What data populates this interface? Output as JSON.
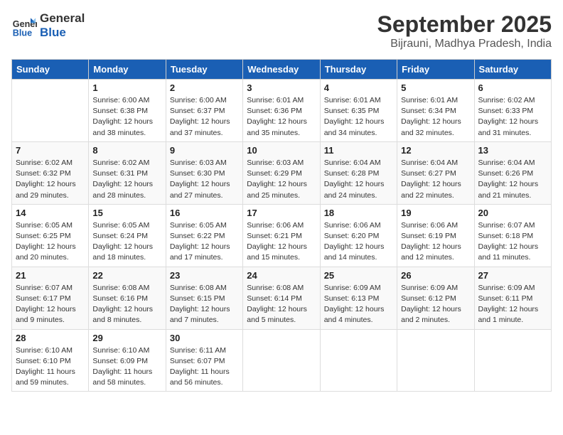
{
  "header": {
    "logo_line1": "General",
    "logo_line2": "Blue",
    "month": "September 2025",
    "location": "Bijrauni, Madhya Pradesh, India"
  },
  "days_of_week": [
    "Sunday",
    "Monday",
    "Tuesday",
    "Wednesday",
    "Thursday",
    "Friday",
    "Saturday"
  ],
  "weeks": [
    [
      {
        "day": "",
        "detail": ""
      },
      {
        "day": "1",
        "detail": "Sunrise: 6:00 AM\nSunset: 6:38 PM\nDaylight: 12 hours\nand 38 minutes."
      },
      {
        "day": "2",
        "detail": "Sunrise: 6:00 AM\nSunset: 6:37 PM\nDaylight: 12 hours\nand 37 minutes."
      },
      {
        "day": "3",
        "detail": "Sunrise: 6:01 AM\nSunset: 6:36 PM\nDaylight: 12 hours\nand 35 minutes."
      },
      {
        "day": "4",
        "detail": "Sunrise: 6:01 AM\nSunset: 6:35 PM\nDaylight: 12 hours\nand 34 minutes."
      },
      {
        "day": "5",
        "detail": "Sunrise: 6:01 AM\nSunset: 6:34 PM\nDaylight: 12 hours\nand 32 minutes."
      },
      {
        "day": "6",
        "detail": "Sunrise: 6:02 AM\nSunset: 6:33 PM\nDaylight: 12 hours\nand 31 minutes."
      }
    ],
    [
      {
        "day": "7",
        "detail": "Sunrise: 6:02 AM\nSunset: 6:32 PM\nDaylight: 12 hours\nand 29 minutes."
      },
      {
        "day": "8",
        "detail": "Sunrise: 6:02 AM\nSunset: 6:31 PM\nDaylight: 12 hours\nand 28 minutes."
      },
      {
        "day": "9",
        "detail": "Sunrise: 6:03 AM\nSunset: 6:30 PM\nDaylight: 12 hours\nand 27 minutes."
      },
      {
        "day": "10",
        "detail": "Sunrise: 6:03 AM\nSunset: 6:29 PM\nDaylight: 12 hours\nand 25 minutes."
      },
      {
        "day": "11",
        "detail": "Sunrise: 6:04 AM\nSunset: 6:28 PM\nDaylight: 12 hours\nand 24 minutes."
      },
      {
        "day": "12",
        "detail": "Sunrise: 6:04 AM\nSunset: 6:27 PM\nDaylight: 12 hours\nand 22 minutes."
      },
      {
        "day": "13",
        "detail": "Sunrise: 6:04 AM\nSunset: 6:26 PM\nDaylight: 12 hours\nand 21 minutes."
      }
    ],
    [
      {
        "day": "14",
        "detail": "Sunrise: 6:05 AM\nSunset: 6:25 PM\nDaylight: 12 hours\nand 20 minutes."
      },
      {
        "day": "15",
        "detail": "Sunrise: 6:05 AM\nSunset: 6:24 PM\nDaylight: 12 hours\nand 18 minutes."
      },
      {
        "day": "16",
        "detail": "Sunrise: 6:05 AM\nSunset: 6:22 PM\nDaylight: 12 hours\nand 17 minutes."
      },
      {
        "day": "17",
        "detail": "Sunrise: 6:06 AM\nSunset: 6:21 PM\nDaylight: 12 hours\nand 15 minutes."
      },
      {
        "day": "18",
        "detail": "Sunrise: 6:06 AM\nSunset: 6:20 PM\nDaylight: 12 hours\nand 14 minutes."
      },
      {
        "day": "19",
        "detail": "Sunrise: 6:06 AM\nSunset: 6:19 PM\nDaylight: 12 hours\nand 12 minutes."
      },
      {
        "day": "20",
        "detail": "Sunrise: 6:07 AM\nSunset: 6:18 PM\nDaylight: 12 hours\nand 11 minutes."
      }
    ],
    [
      {
        "day": "21",
        "detail": "Sunrise: 6:07 AM\nSunset: 6:17 PM\nDaylight: 12 hours\nand 9 minutes."
      },
      {
        "day": "22",
        "detail": "Sunrise: 6:08 AM\nSunset: 6:16 PM\nDaylight: 12 hours\nand 8 minutes."
      },
      {
        "day": "23",
        "detail": "Sunrise: 6:08 AM\nSunset: 6:15 PM\nDaylight: 12 hours\nand 7 minutes."
      },
      {
        "day": "24",
        "detail": "Sunrise: 6:08 AM\nSunset: 6:14 PM\nDaylight: 12 hours\nand 5 minutes."
      },
      {
        "day": "25",
        "detail": "Sunrise: 6:09 AM\nSunset: 6:13 PM\nDaylight: 12 hours\nand 4 minutes."
      },
      {
        "day": "26",
        "detail": "Sunrise: 6:09 AM\nSunset: 6:12 PM\nDaylight: 12 hours\nand 2 minutes."
      },
      {
        "day": "27",
        "detail": "Sunrise: 6:09 AM\nSunset: 6:11 PM\nDaylight: 12 hours\nand 1 minute."
      }
    ],
    [
      {
        "day": "28",
        "detail": "Sunrise: 6:10 AM\nSunset: 6:10 PM\nDaylight: 11 hours\nand 59 minutes."
      },
      {
        "day": "29",
        "detail": "Sunrise: 6:10 AM\nSunset: 6:09 PM\nDaylight: 11 hours\nand 58 minutes."
      },
      {
        "day": "30",
        "detail": "Sunrise: 6:11 AM\nSunset: 6:07 PM\nDaylight: 11 hours\nand 56 minutes."
      },
      {
        "day": "",
        "detail": ""
      },
      {
        "day": "",
        "detail": ""
      },
      {
        "day": "",
        "detail": ""
      },
      {
        "day": "",
        "detail": ""
      }
    ]
  ]
}
